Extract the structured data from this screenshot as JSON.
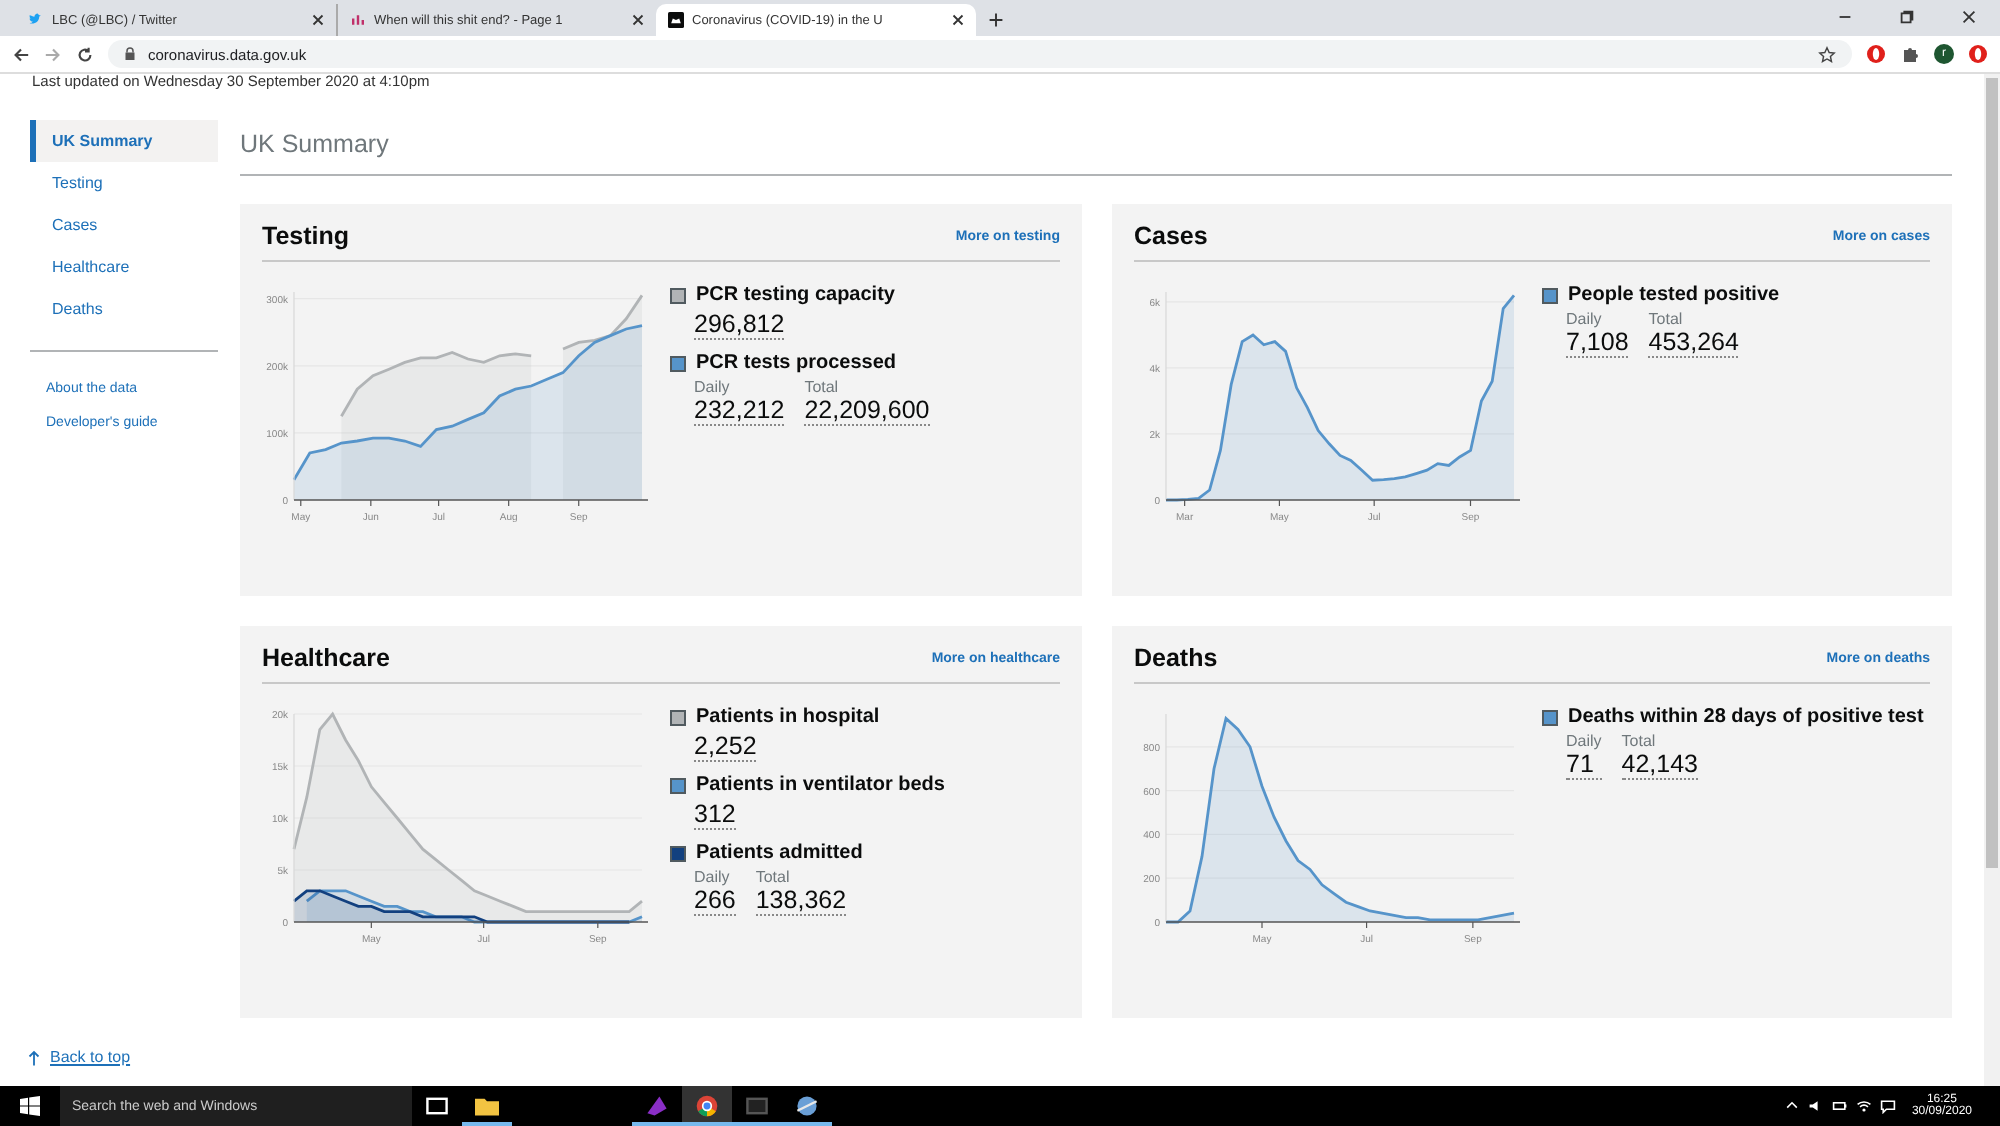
{
  "browser": {
    "tabs": [
      {
        "title": "LBC (@LBC) / Twitter",
        "selected": false
      },
      {
        "title": "When will this shit end? - Page 1",
        "selected": false
      },
      {
        "title": "Coronavirus (COVID-19) in the U",
        "selected": true
      }
    ],
    "url": "coronavirus.data.gov.uk",
    "profile_initial": "r"
  },
  "page": {
    "last_updated": "Last updated on Wednesday 30 September 2020 at 4:10pm",
    "sidebar": {
      "items": [
        {
          "label": "UK Summary",
          "selected": true
        },
        {
          "label": "Testing",
          "selected": false
        },
        {
          "label": "Cases",
          "selected": false
        },
        {
          "label": "Healthcare",
          "selected": false
        },
        {
          "label": "Deaths",
          "selected": false
        }
      ],
      "links": [
        "About the data",
        "Developer's guide"
      ]
    },
    "heading": "UK Summary",
    "sections": [
      {
        "title": "Testing",
        "more_link": "More on testing",
        "metrics": [
          {
            "values": [
              {
                "value": "296,812"
              }
            ]
          },
          {
            "values": [
              {
                "label": "Daily",
                "value": "232,212"
              },
              {
                "label": "Total",
                "value": "22,209,600"
              }
            ]
          }
        ],
        "chart_data": {
          "type": "area",
          "grid": true,
          "xlim": [
            "2020-04-28",
            "2020-09-29"
          ],
          "x": [
            "2020-04-28",
            "2020-05-05",
            "2020-05-12",
            "2020-05-19",
            "2020-05-26",
            "2020-06-02",
            "2020-06-09",
            "2020-06-16",
            "2020-06-23",
            "2020-06-30",
            "2020-07-07",
            "2020-07-14",
            "2020-07-21",
            "2020-07-28",
            "2020-08-04",
            "2020-08-11",
            "2020-08-18",
            "2020-08-25",
            "2020-09-01",
            "2020-09-08",
            "2020-09-15",
            "2020-09-22",
            "2020-09-29"
          ],
          "series": [
            {
              "name": "PCR testing capacity",
              "color": "#b1b4b6",
              "values": [
                null,
                null,
                null,
                125000,
                165000,
                185000,
                195000,
                205000,
                212000,
                212000,
                220000,
                210000,
                205000,
                215000,
                218000,
                215000,
                null,
                225000,
                235000,
                238000,
                245000,
                270000,
                305000
              ]
            },
            {
              "name": "PCR tests processed",
              "color": "#5694ca",
              "values": [
                30000,
                70000,
                75000,
                85000,
                88000,
                92000,
                92000,
                88000,
                80000,
                105000,
                110000,
                120000,
                130000,
                155000,
                165000,
                170000,
                180000,
                190000,
                215000,
                235000,
                245000,
                255000,
                260000
              ]
            }
          ],
          "ylim": [
            0,
            310000
          ],
          "yticks": [
            {
              "value": 0,
              "label": "0"
            },
            {
              "value": 100000,
              "label": "100k"
            },
            {
              "value": 200000,
              "label": "200k"
            },
            {
              "value": 300000,
              "label": "300k"
            }
          ],
          "xticks": [
            {
              "value": "2020-05-01",
              "label": "May"
            },
            {
              "value": "2020-06-01",
              "label": "Jun"
            },
            {
              "value": "2020-07-01",
              "label": "Jul"
            },
            {
              "value": "2020-08-01",
              "label": "Aug"
            },
            {
              "value": "2020-09-01",
              "label": "Sep"
            }
          ]
        }
      },
      {
        "title": "Cases",
        "more_link": "More on cases",
        "metrics": [
          {
            "values": [
              {
                "label": "Daily",
                "value": "7,108"
              },
              {
                "label": "Total",
                "value": "453,264"
              }
            ]
          }
        ],
        "chart_data": {
          "type": "area",
          "grid": true,
          "xlim": [
            "2020-02-18",
            "2020-09-29"
          ],
          "x": [
            "2020-02-18",
            "2020-02-25",
            "2020-03-03",
            "2020-03-10",
            "2020-03-17",
            "2020-03-24",
            "2020-03-31",
            "2020-04-07",
            "2020-04-14",
            "2020-04-21",
            "2020-04-28",
            "2020-05-05",
            "2020-05-12",
            "2020-05-19",
            "2020-05-26",
            "2020-06-02",
            "2020-06-09",
            "2020-06-16",
            "2020-06-23",
            "2020-06-30",
            "2020-07-07",
            "2020-07-14",
            "2020-07-21",
            "2020-07-28",
            "2020-08-04",
            "2020-08-11",
            "2020-08-18",
            "2020-08-25",
            "2020-09-01",
            "2020-09-08",
            "2020-09-15",
            "2020-09-22",
            "2020-09-29"
          ],
          "series": [
            {
              "name": "People tested positive",
              "color": "#5694ca",
              "values": [
                0,
                0,
                20,
                50,
                300,
                1500,
                3500,
                4800,
                5000,
                4700,
                4800,
                4500,
                3400,
                2800,
                2100,
                1700,
                1350,
                1200,
                900,
                600,
                620,
                650,
                700,
                800,
                900,
                1100,
                1050,
                1300,
                1500,
                3000,
                3600,
                5800,
                6200
              ]
            }
          ],
          "ylim": [
            0,
            6300
          ],
          "yticks": [
            {
              "value": 0,
              "label": "0"
            },
            {
              "value": 2000,
              "label": "2k"
            },
            {
              "value": 4000,
              "label": "4k"
            },
            {
              "value": 6000,
              "label": "6k"
            }
          ],
          "xticks": [
            {
              "value": "2020-03-01",
              "label": "Mar"
            },
            {
              "value": "2020-05-01",
              "label": "May"
            },
            {
              "value": "2020-07-01",
              "label": "Jul"
            },
            {
              "value": "2020-09-01",
              "label": "Sep"
            }
          ]
        }
      },
      {
        "title": "Healthcare",
        "more_link": "More on healthcare",
        "metrics": [
          {
            "values": [
              {
                "value": "2,252"
              }
            ]
          },
          {
            "values": [
              {
                "value": "312"
              }
            ]
          },
          {
            "values": [
              {
                "label": "Daily",
                "value": "266"
              },
              {
                "label": "Total",
                "value": "138,362"
              }
            ]
          }
        ],
        "chart_data": {
          "type": "area",
          "grid": true,
          "xlim": [
            "2020-03-20",
            "2020-09-25"
          ],
          "x": [
            "2020-03-20",
            "2020-03-27",
            "2020-04-03",
            "2020-04-10",
            "2020-04-17",
            "2020-04-24",
            "2020-05-01",
            "2020-05-08",
            "2020-05-15",
            "2020-05-22",
            "2020-05-29",
            "2020-06-05",
            "2020-06-12",
            "2020-06-19",
            "2020-06-26",
            "2020-07-03",
            "2020-07-10",
            "2020-07-17",
            "2020-07-24",
            "2020-07-31",
            "2020-08-07",
            "2020-08-14",
            "2020-08-21",
            "2020-08-28",
            "2020-09-04",
            "2020-09-11",
            "2020-09-18",
            "2020-09-25"
          ],
          "series": [
            {
              "name": "Patients in hospital",
              "color": "#b1b4b6",
              "values": [
                7000,
                12000,
                18500,
                20000,
                17500,
                15500,
                13000,
                11500,
                10000,
                8500,
                7000,
                6000,
                5000,
                4000,
                3000,
                2500,
                2000,
                1500,
                1000,
                1000,
                1000,
                1000,
                1000,
                1000,
                1000,
                1000,
                1000,
                2000
              ]
            },
            {
              "name": "Patients in ventilator beds",
              "color": "#5694ca",
              "values": [
                null,
                2000,
                3000,
                3000,
                3000,
                2500,
                2000,
                1500,
                1500,
                1000,
                1000,
                500,
                500,
                500,
                0,
                0,
                0,
                0,
                0,
                0,
                0,
                0,
                0,
                0,
                0,
                0,
                0,
                500
              ]
            },
            {
              "name": "Patients admitted",
              "color": "#12407f",
              "values": [
                2000,
                3000,
                3000,
                2500,
                2000,
                1500,
                1500,
                1000,
                1000,
                1000,
                500,
                500,
                500,
                500,
                500,
                0,
                0,
                0,
                0,
                0,
                0,
                0,
                0,
                0,
                0,
                0,
                0,
                null
              ]
            }
          ],
          "ylim": [
            0,
            20000
          ],
          "yticks": [
            {
              "value": 0,
              "label": "0"
            },
            {
              "value": 5000,
              "label": "5k"
            },
            {
              "value": 10000,
              "label": "10k"
            },
            {
              "value": 15000,
              "label": "15k"
            },
            {
              "value": 20000,
              "label": "20k"
            }
          ],
          "xticks": [
            {
              "value": "2020-05-01",
              "label": "May"
            },
            {
              "value": "2020-07-01",
              "label": "Jul"
            },
            {
              "value": "2020-09-01",
              "label": "Sep"
            }
          ]
        }
      },
      {
        "title": "Deaths",
        "more_link": "More on deaths",
        "metrics": [
          {
            "values": [
              {
                "label": "Daily",
                "value": "71"
              },
              {
                "label": "Total",
                "value": "42,143"
              }
            ]
          }
        ],
        "chart_data": {
          "type": "area",
          "grid": true,
          "xlim": [
            "2020-03-06",
            "2020-09-25"
          ],
          "x": [
            "2020-03-06",
            "2020-03-13",
            "2020-03-20",
            "2020-03-27",
            "2020-04-03",
            "2020-04-10",
            "2020-04-17",
            "2020-04-24",
            "2020-05-01",
            "2020-05-08",
            "2020-05-15",
            "2020-05-22",
            "2020-05-29",
            "2020-06-05",
            "2020-06-12",
            "2020-06-19",
            "2020-06-26",
            "2020-07-03",
            "2020-07-10",
            "2020-07-17",
            "2020-07-24",
            "2020-07-31",
            "2020-08-07",
            "2020-08-14",
            "2020-08-21",
            "2020-08-28",
            "2020-09-04",
            "2020-09-11",
            "2020-09-18",
            "2020-09-25"
          ],
          "series": [
            {
              "name": "Deaths within 28 days of positive test",
              "color": "#5694ca",
              "values": [
                0,
                0,
                50,
                300,
                700,
                930,
                880,
                800,
                620,
                480,
                370,
                280,
                240,
                170,
                130,
                90,
                70,
                50,
                40,
                30,
                20,
                20,
                10,
                10,
                10,
                10,
                10,
                20,
                30,
                40
              ]
            }
          ],
          "ylim": [
            0,
            950
          ],
          "yticks": [
            {
              "value": 0,
              "label": "0"
            },
            {
              "value": 200,
              "label": "200"
            },
            {
              "value": 400,
              "label": "400"
            },
            {
              "value": 600,
              "label": "600"
            },
            {
              "value": 800,
              "label": "800"
            }
          ],
          "xticks": [
            {
              "value": "2020-05-01",
              "label": "May"
            },
            {
              "value": "2020-07-01",
              "label": "Jul"
            },
            {
              "value": "2020-09-01",
              "label": "Sep"
            }
          ]
        }
      }
    ],
    "back_to_top": "Back to top"
  },
  "taskbar": {
    "search_placeholder": "Search the web and Windows",
    "time": "16:25",
    "date": "30/09/2020"
  }
}
